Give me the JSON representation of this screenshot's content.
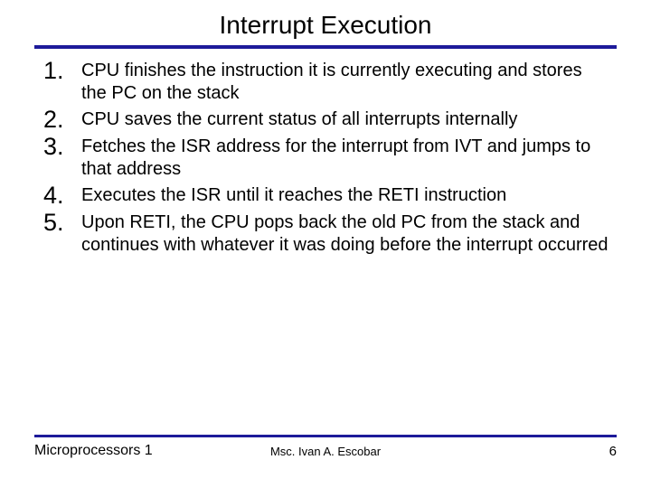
{
  "title": "Interrupt Execution",
  "items": [
    {
      "n": "1.",
      "t": "CPU finishes the instruction it is currently executing and stores the PC on the stack"
    },
    {
      "n": "2.",
      "t": "CPU saves the current status of all interrupts internally"
    },
    {
      "n": "3.",
      "t": "Fetches the ISR address for the interrupt from IVT and jumps to that address"
    },
    {
      "n": "4.",
      "t": "Executes the ISR until it reaches the RETI instruction"
    },
    {
      "n": "5.",
      "t": "Upon RETI, the CPU pops back the old PC from the stack and continues with whatever it was doing before the interrupt occurred"
    }
  ],
  "footer": {
    "left": "Microprocessors 1",
    "center": "Msc. Ivan A. Escobar",
    "page": "6"
  }
}
